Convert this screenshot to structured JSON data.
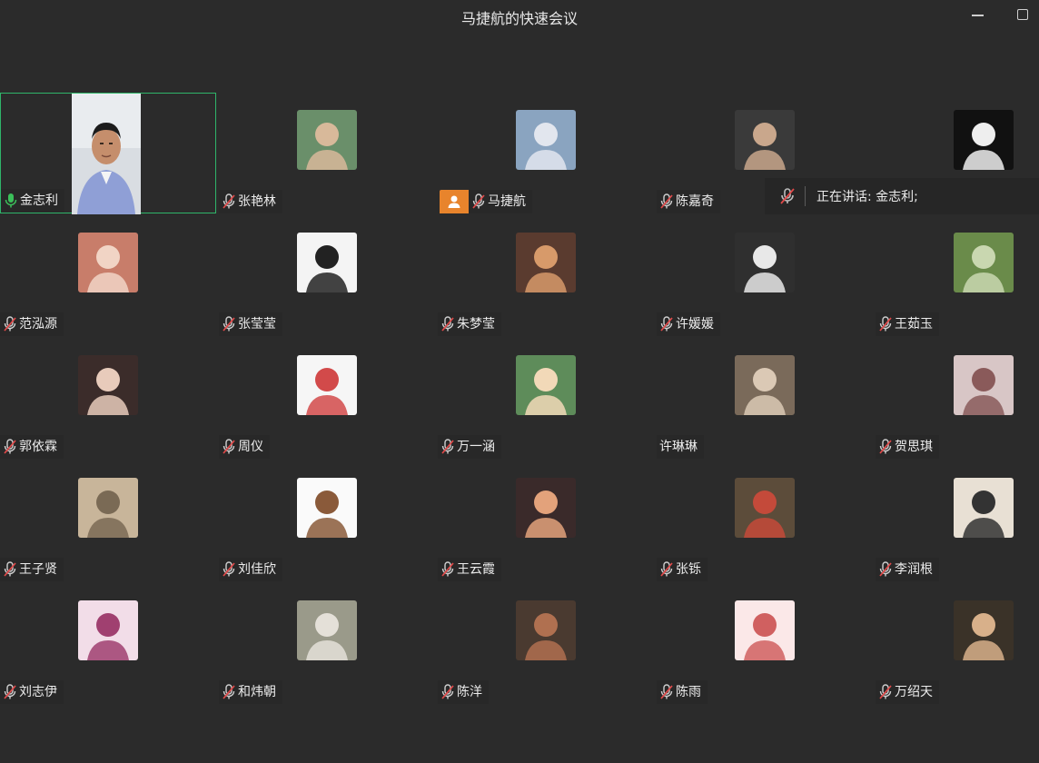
{
  "window": {
    "title": "马捷航的快速会议"
  },
  "speaking": {
    "text": "正在讲话: 金志利;"
  },
  "participants": [
    {
      "name": "金志利",
      "mic": "on",
      "video": true
    },
    {
      "name": "张艳林",
      "mic": "muted"
    },
    {
      "name": "马捷航",
      "mic": "muted",
      "host": true
    },
    {
      "name": "陈嘉奇",
      "mic": "muted"
    },
    {
      "name": "",
      "mic": "none"
    },
    {
      "name": "范泓源",
      "mic": "muted"
    },
    {
      "name": "张莹莹",
      "mic": "muted"
    },
    {
      "name": "朱梦莹",
      "mic": "muted"
    },
    {
      "name": "许媛媛",
      "mic": "muted"
    },
    {
      "name": "王茹玉",
      "mic": "muted"
    },
    {
      "name": "郭依霖",
      "mic": "muted"
    },
    {
      "name": "周仪",
      "mic": "muted"
    },
    {
      "name": "万一涵",
      "mic": "muted"
    },
    {
      "name": "许琳琳",
      "mic": "none"
    },
    {
      "name": "贺思琪",
      "mic": "muted"
    },
    {
      "name": "王子贤",
      "mic": "muted"
    },
    {
      "name": "刘佳欣",
      "mic": "muted"
    },
    {
      "name": "王云霞",
      "mic": "muted"
    },
    {
      "name": "张铄",
      "mic": "muted"
    },
    {
      "name": "李润根",
      "mic": "muted"
    },
    {
      "name": "刘志伊",
      "mic": "muted"
    },
    {
      "name": "和炜朝",
      "mic": "muted"
    },
    {
      "name": "陈洋",
      "mic": "muted"
    },
    {
      "name": "陈雨",
      "mic": "muted"
    },
    {
      "name": "万绍天",
      "mic": "muted"
    }
  ],
  "colors": {
    "active_border": "#2fb56a",
    "host_badge": "#e8842c",
    "mic_on": "#3bbf5a",
    "mic_muted": "#e24a4a"
  }
}
